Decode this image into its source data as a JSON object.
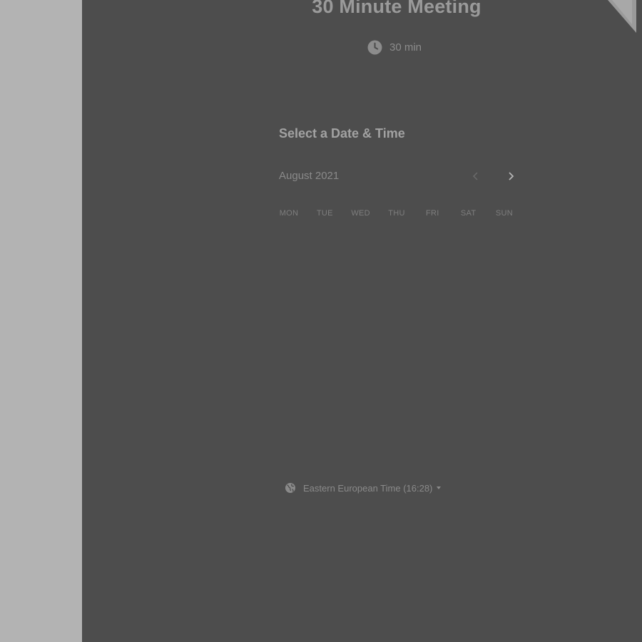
{
  "event": {
    "title": "30 Minute Meeting",
    "duration": "30 min",
    "duration_icon": "clock-icon"
  },
  "calendar": {
    "heading": "Select a Date & Time",
    "month": "August 2021",
    "prev_icon": "chevron-left-icon",
    "next_icon": "chevron-right-icon",
    "weekdays": [
      "MON",
      "TUE",
      "WED",
      "THU",
      "FRI",
      "SAT",
      "SUN"
    ]
  },
  "timezone": {
    "label": "Eastern European Time (16:28)",
    "icon": "globe-icon"
  },
  "colors": {
    "page_background": "#b3b3b3",
    "panel_background": "#4d4d4d"
  }
}
